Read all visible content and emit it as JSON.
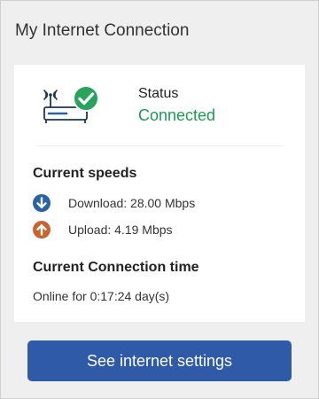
{
  "widget": {
    "title": "My Internet Connection"
  },
  "status": {
    "label": "Status",
    "value": "Connected",
    "icon": "router-connected-icon",
    "check_icon": "check-circle-icon",
    "value_color": "#1c9a52"
  },
  "speeds": {
    "heading": "Current speeds",
    "download": {
      "icon": "download-arrow-icon",
      "text": "Download: 28.00 Mbps",
      "color": "#2b62a6"
    },
    "upload": {
      "icon": "upload-arrow-icon",
      "text": "Upload: 4.19 Mbps",
      "color": "#c7652e"
    }
  },
  "connection_time": {
    "heading": "Current Connection time",
    "text": "Online for 0:17:24 day(s)"
  },
  "actions": {
    "settings_button": "See internet settings",
    "button_color": "#2f5aa8"
  }
}
